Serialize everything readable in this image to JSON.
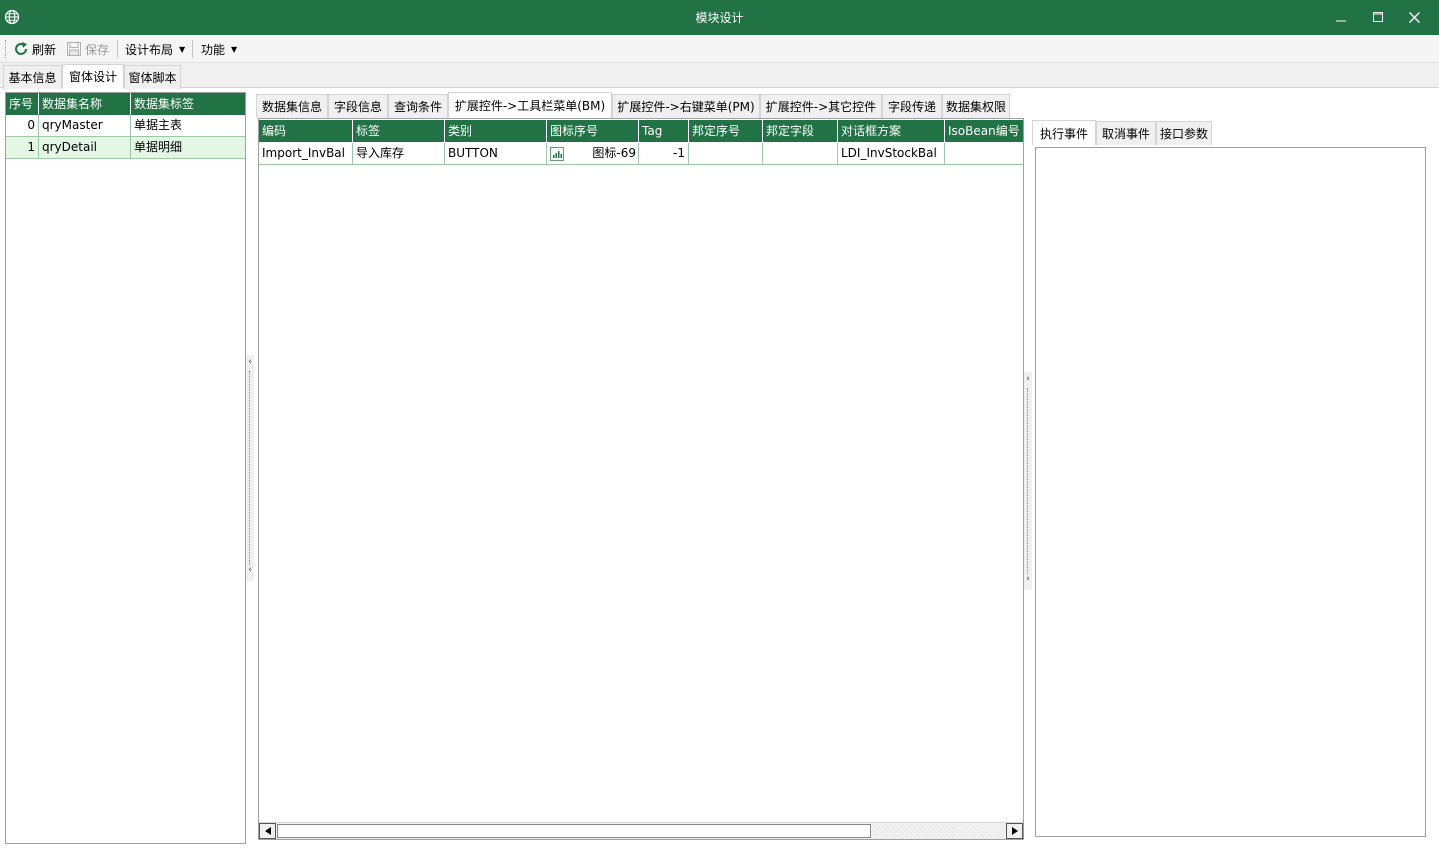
{
  "window": {
    "title": "模块设计",
    "icons": {
      "app": "globe-icon",
      "minimize": "minimize-icon",
      "maximize": "maximize-icon",
      "close": "close-icon"
    }
  },
  "toolbar": {
    "refresh_label": "刷新",
    "save_label": "保存",
    "design_layout_label": "设计布局",
    "function_label": "功能"
  },
  "main_tabs": [
    {
      "label": "基本信息"
    },
    {
      "label": "窗体设计"
    },
    {
      "label": "窗体脚本"
    }
  ],
  "dataset_grid": {
    "headers": [
      "序号",
      "数据集名称",
      "数据集标签"
    ],
    "rows": [
      {
        "index": "0",
        "name": "qryMaster",
        "label": "单据主表"
      },
      {
        "index": "1",
        "name": "qryDetail",
        "label": "单据明细"
      }
    ]
  },
  "detail_tabs": [
    {
      "label": "数据集信息"
    },
    {
      "label": "字段信息"
    },
    {
      "label": "查询条件"
    },
    {
      "label": "扩展控件->工具栏菜单(BM)"
    },
    {
      "label": "扩展控件->右键菜单(PM)"
    },
    {
      "label": "扩展控件->其它控件"
    },
    {
      "label": "字段传递"
    },
    {
      "label": "数据集权限"
    }
  ],
  "toolbar_grid": {
    "headers": [
      "编码",
      "标签",
      "类别",
      "图标序号",
      "Tag",
      "邦定序号",
      "邦定字段",
      "对话框方案",
      "IsoBean编号"
    ],
    "rows": [
      {
        "code": "Import_InvBal",
        "label": "导入库存",
        "type": "BUTTON",
        "icon": "图标-69",
        "tag": "-1",
        "bind_index": "",
        "bind_field": "",
        "dialog": "LDI_InvStockBal",
        "isobean": ""
      }
    ]
  },
  "event_tabs": [
    {
      "label": "执行事件"
    },
    {
      "label": "取消事件"
    },
    {
      "label": "接口参数"
    }
  ],
  "colors": {
    "accent": "#217346",
    "row_alt": "#e4f6e4",
    "grid_line": "#9cc8a5"
  }
}
